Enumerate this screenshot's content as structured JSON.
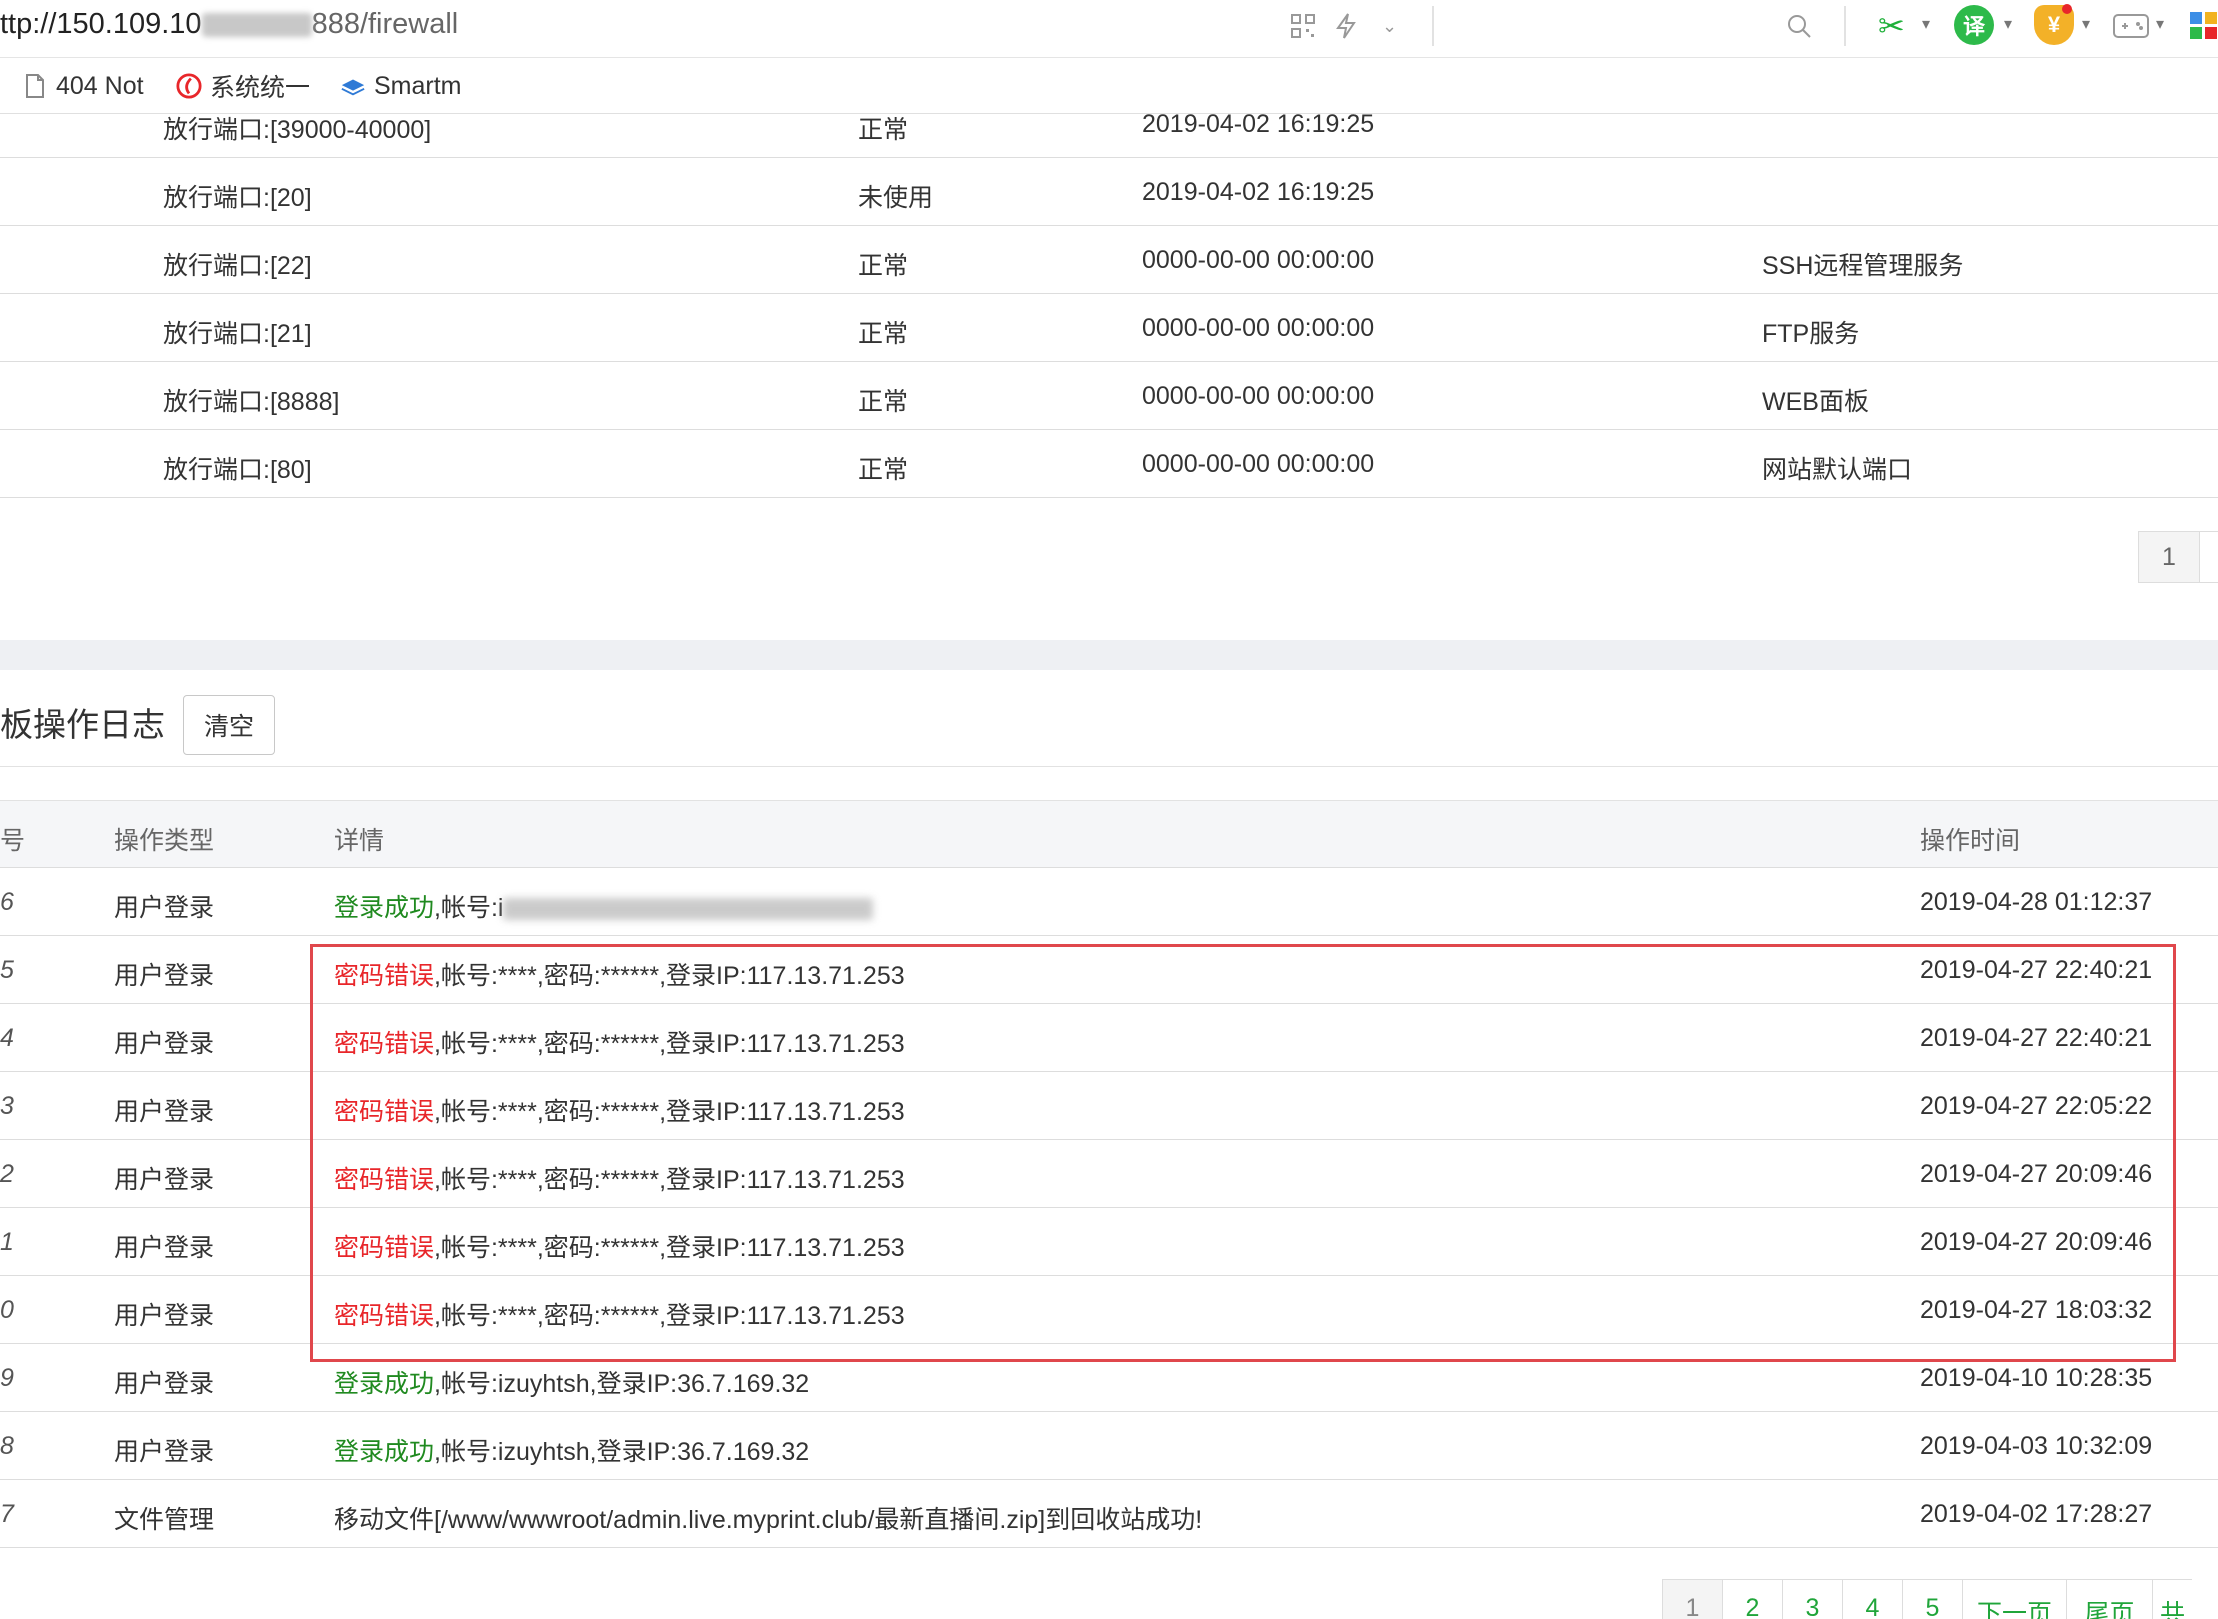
{
  "browser": {
    "url_prefix": "ttp://150.109.10",
    "url_suffix": "888/firewall",
    "bookmarks": [
      "404 Not",
      "系统统一",
      "Smartm"
    ],
    "ext_translate": "译",
    "ext_shield": "¥"
  },
  "firewall": {
    "rows": [
      {
        "port": "放行端口:[39000-40000]",
        "status": "正常",
        "time": "2019-04-02 16:19:25",
        "note": ""
      },
      {
        "port": "放行端口:[20]",
        "status": "未使用",
        "time": "2019-04-02 16:19:25",
        "note": ""
      },
      {
        "port": "放行端口:[22]",
        "status": "正常",
        "time": "0000-00-00 00:00:00",
        "note": "SSH远程管理服务"
      },
      {
        "port": "放行端口:[21]",
        "status": "正常",
        "time": "0000-00-00 00:00:00",
        "note": "FTP服务"
      },
      {
        "port": "放行端口:[8888]",
        "status": "正常",
        "time": "0000-00-00 00:00:00",
        "note": "WEB面板"
      },
      {
        "port": "放行端口:[80]",
        "status": "正常",
        "time": "0000-00-00 00:00:00",
        "note": "网站默认端口"
      }
    ],
    "page": "1"
  },
  "log": {
    "title": "板操作日志",
    "clear_label": "清空",
    "headers": {
      "num": "号",
      "type": "操作类型",
      "detail": "详情",
      "time": "操作时间"
    },
    "rows": [
      {
        "num": "6",
        "type": "用户登录",
        "status": "登录成功",
        "status_kind": "ok",
        "detail": ",帐号:i",
        "time": "2019-04-28 01:12:37"
      },
      {
        "num": "5",
        "type": "用户登录",
        "status": "密码错误",
        "status_kind": "err",
        "detail": ",帐号:****,密码:******,登录IP:117.13.71.253",
        "time": "2019-04-27 22:40:21"
      },
      {
        "num": "4",
        "type": "用户登录",
        "status": "密码错误",
        "status_kind": "err",
        "detail": ",帐号:****,密码:******,登录IP:117.13.71.253",
        "time": "2019-04-27 22:40:21"
      },
      {
        "num": "3",
        "type": "用户登录",
        "status": "密码错误",
        "status_kind": "err",
        "detail": ",帐号:****,密码:******,登录IP:117.13.71.253",
        "time": "2019-04-27 22:05:22"
      },
      {
        "num": "2",
        "type": "用户登录",
        "status": "密码错误",
        "status_kind": "err",
        "detail": ",帐号:****,密码:******,登录IP:117.13.71.253",
        "time": "2019-04-27 20:09:46"
      },
      {
        "num": "1",
        "type": "用户登录",
        "status": "密码错误",
        "status_kind": "err",
        "detail": ",帐号:****,密码:******,登录IP:117.13.71.253",
        "time": "2019-04-27 20:09:46"
      },
      {
        "num": "0",
        "type": "用户登录",
        "status": "密码错误",
        "status_kind": "err",
        "detail": ",帐号:****,密码:******,登录IP:117.13.71.253",
        "time": "2019-04-27 18:03:32"
      },
      {
        "num": "9",
        "type": "用户登录",
        "status": "登录成功",
        "status_kind": "ok",
        "detail": ",帐号:izuyhtsh,登录IP:36.7.169.32",
        "time": "2019-04-10 10:28:35"
      },
      {
        "num": "8",
        "type": "用户登录",
        "status": "登录成功",
        "status_kind": "ok",
        "detail": ",帐号:izuyhtsh,登录IP:36.7.169.32",
        "time": "2019-04-03 10:32:09"
      },
      {
        "num": "7",
        "type": "文件管理",
        "status": "",
        "status_kind": "none",
        "detail": "移动文件[/www/wwwroot/admin.live.myprint.club/最新直播间.zip]到回收站成功!",
        "time": "2019-04-02 17:28:27"
      }
    ],
    "pager": [
      "1",
      "2",
      "3",
      "4",
      "5",
      "下一页",
      "尾页",
      "共"
    ]
  },
  "colors": {
    "success": "#208a20",
    "error": "#e8262a",
    "highlight": "#e0474c",
    "pager_link": "#20a53a"
  }
}
